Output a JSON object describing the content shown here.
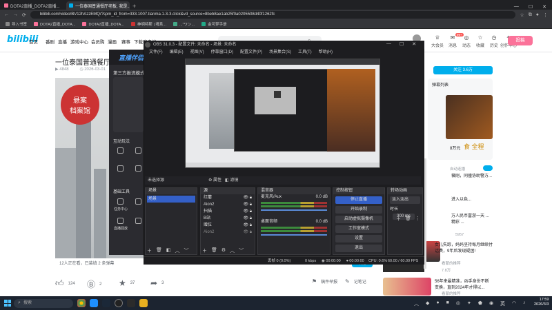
{
  "browser": {
    "tabs": [
      {
        "label": "DOTA2直播_DOTA2直播...",
        "active": false
      },
      {
        "label": "一位泰国普通餐厅老板, 我是...",
        "active": true
      }
    ],
    "url": "bilibili.com/video/BV12hAzzEMQ/?spm_id_from=333.1007.tianma.1-3-3.click&vd_source=8beb8ae1ab25f0a0205508d40f1262fc",
    "bookmarks": [
      "导入书签",
      "DOTA2直播_DOTA...",
      "DOTA2直播_DOTA...",
      "神明特斯 | 魂系...",
      "...\"ワン...",
      "金可梦手册"
    ]
  },
  "bili": {
    "logo": "bilibili",
    "nav": [
      "首页",
      "番剧",
      "直播",
      "游戏中心",
      "会员购",
      "漫画",
      "赛事",
      "下载客户端"
    ],
    "header_icons": [
      {
        "label": "大会员",
        "icon": "crown-icon"
      },
      {
        "label": "消息",
        "icon": "message-icon",
        "badge": "99+"
      },
      {
        "label": "动态",
        "icon": "dynamic-icon"
      },
      {
        "label": "收藏",
        "icon": "star-icon"
      },
      {
        "label": "历史",
        "icon": "history-icon"
      },
      {
        "label": "创作中心",
        "icon": "bulb-icon"
      }
    ],
    "upload_label": "投稿",
    "video_title": "一位泰国普通餐厅老...",
    "meta_views": "4848",
    "meta_date": "2026-03-01",
    "caption": "12人正在看，已装填 2 条弹幕",
    "send_danmu": "发送",
    "actions": [
      {
        "icon": "like-icon",
        "count": "124"
      },
      {
        "icon": "coin-icon",
        "count": "2"
      },
      {
        "icon": "collect-icon",
        "count": "37"
      },
      {
        "icon": "share-icon",
        "count": "3"
      }
    ],
    "report": "稿件举报",
    "notes": "记笔记"
  },
  "tool": {
    "title": "直播伴侣",
    "mode": "第三方推流模式",
    "section_interact": "互动玩法",
    "section_basic": "基础工具",
    "basic_items": [
      "任务中心",
      "",
      "",
      "直播回放"
    ]
  },
  "sidebar": {
    "follow": "关注 3.6万",
    "danmu_list": "弹幕列表",
    "autoplay": "自动连播",
    "items": [
      {
        "title": "8万元",
        "sub": ""
      },
      {
        "title": "薇刚，同撞协助警方...",
        "sub": ""
      },
      {
        "title": "进入以色...",
        "sub": ""
      },
      {
        "title": "万人民币富游一天 ...精彩 ...",
        "sub": ""
      },
      {
        "title": "女儿失踪，妈妈坚持每月继续付话费，9年后发现疑团!",
        "sub": "看蒙的推荐"
      },
      {
        "title": "56年来最精准，凶手身份不断变换，直到2024年才得以...",
        "sub": "看蒙的推荐"
      }
    ],
    "sub_counts": [
      "7.2万",
      "5957",
      "7.8万"
    ]
  },
  "obs": {
    "title": "OBS 31.0.3 - 配置文件: 未命名 - 场景: 未命名",
    "menu": [
      "文件(F)",
      "编辑(E)",
      "视图(V)",
      "停靠窗口(D)",
      "配置文件(P)",
      "场景集合(S)",
      "工具(T)",
      "帮助(H)"
    ],
    "no_source": "未选择源",
    "props": "属性",
    "filters": "滤镜",
    "scenes_header": "场景",
    "scenes": [
      "场景"
    ],
    "sources_header": "源",
    "sources": [
      "红蘑",
      "Aion2",
      "扫描",
      "B站",
      "赠位",
      "Aion2"
    ],
    "mixer_header": "混音器",
    "mixer": [
      {
        "name": "麦克风/Aux",
        "db": "0.0 dB"
      },
      {
        "name": "桌面音频",
        "db": "0.0 dB"
      }
    ],
    "controls_header": "控制按钮",
    "controls": [
      "停止直播",
      "开始录制",
      "启动虚拟摄像机",
      "工作室模式",
      "设置",
      "退出"
    ],
    "transitions_header": "转场动画",
    "transition": "淡入淡出",
    "duration_label": "时长",
    "duration": "300 ms",
    "status": {
      "frames": "丢帧 0 (0.0%)",
      "kbps": "0 kbps",
      "live_time": "00:00:00",
      "rec_time": "00:00:00",
      "cpu": "CPU: 0.6%",
      "fps": "60.00 / 60.00 FPS"
    }
  },
  "taskbar": {
    "search": "搜索",
    "lang": "英",
    "time": "17:59",
    "date": "2026/3/3"
  }
}
